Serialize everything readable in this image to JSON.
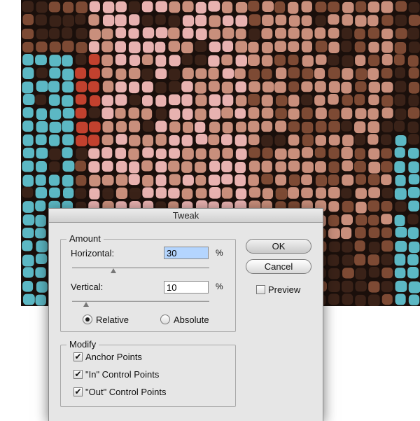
{
  "dialog": {
    "title": "Tweak",
    "amount": {
      "legend": "Amount",
      "horizontal_label": "Horizontal:",
      "horizontal_value": "30",
      "horizontal_unit": "%",
      "horizontal_slider_level": 0.3,
      "vertical_label": "Vertical:",
      "vertical_value": "10",
      "vertical_unit": "%",
      "vertical_slider_level": 0.1,
      "relative_label": "Relative",
      "absolute_label": "Absolute",
      "relative_selected": true
    },
    "modify": {
      "legend": "Modify",
      "anchor_label": "Anchor Points",
      "anchor_checked": true,
      "in_label": "\"In\" Control Points",
      "in_checked": true,
      "out_label": "\"Out\" Control Points",
      "out_checked": true
    },
    "ok_label": "OK",
    "cancel_label": "Cancel",
    "preview_label": "Preview",
    "preview_checked": false
  },
  "artwork": {
    "palette": [
      "#5cb8c4",
      "#e8b2b0",
      "#c98f7c",
      "#7d4a34",
      "#3a2218",
      "#c2412e"
    ]
  }
}
